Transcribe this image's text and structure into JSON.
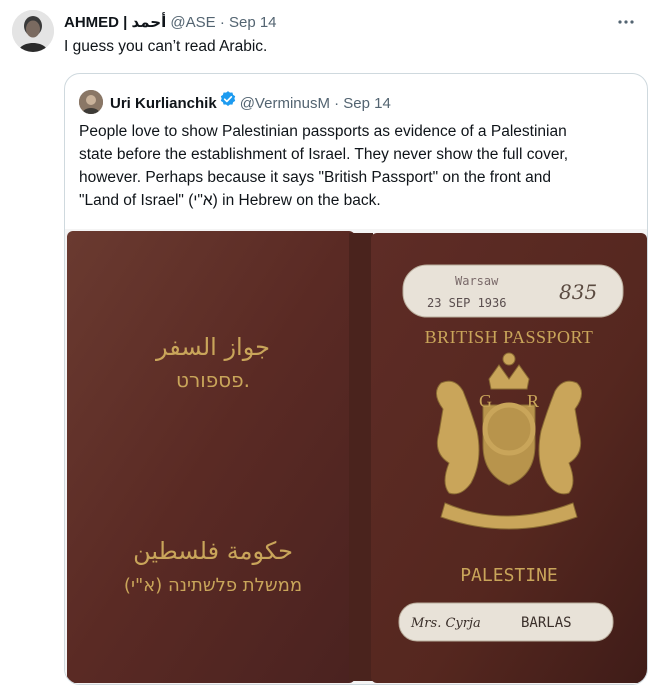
{
  "tweet": {
    "display_name": "AHMED | أحمد",
    "handle": "@ASE",
    "separator": "·",
    "date": "Sep 14",
    "more_icon": "more-horizontal-icon",
    "text": "I guess you can’t read Arabic."
  },
  "quote": {
    "display_name": "Uri Kurlianchik",
    "handle": "@VerminusM",
    "separator": "·",
    "date": "Sep 14",
    "verified_color": "#1d9bf0",
    "text_lines": [
      "People love to show Palestinian passports as evidence of a Palestinian",
      "state before the establishment of Israel. They never show the full cover,",
      "however. Perhaps because it says \"British Passport\" on the front and",
      "\"Land of Israel\" (א\"י) in Hebrew on the back."
    ]
  },
  "passport": {
    "back_arabic_top": "جواز السفر",
    "back_hebrew_top": "פספורט.",
    "back_arabic_bottom": "حكومة فلسطين",
    "back_hebrew_bottom": "ממשלת פלשתינה (א\"י)",
    "stamp_city": "Warsaw",
    "stamp_date": "23 SEP 1936",
    "stamp_number": "835",
    "front_title": "BRITISH PASSPORT",
    "front_country": "PALESTINE",
    "holder_prefix": "Mrs. Cyrja",
    "holder_surname": "BARLAS",
    "colors": {
      "cover": "#5a2a24",
      "gold": "#c9a55a",
      "label": "#e8e2d8"
    }
  }
}
